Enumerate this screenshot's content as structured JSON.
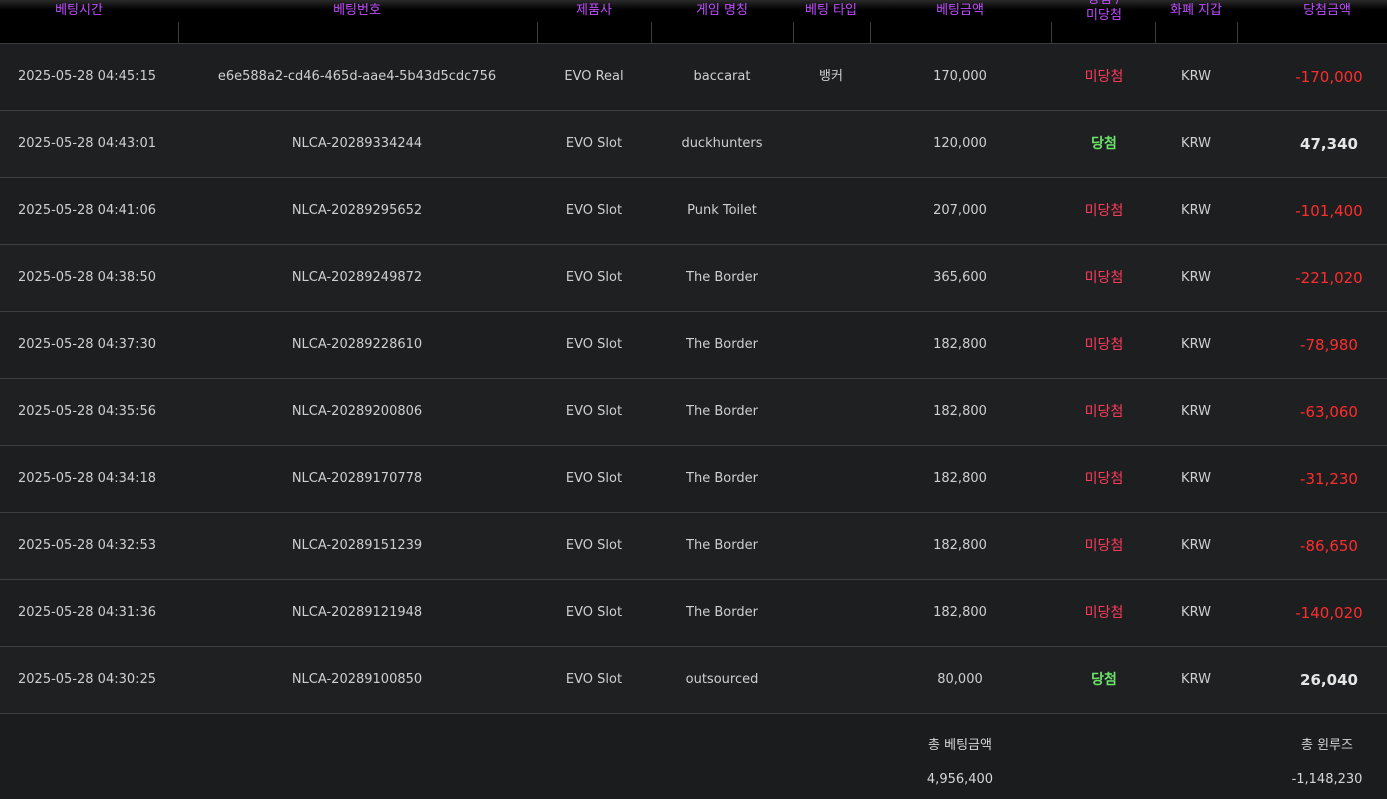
{
  "headers": {
    "time": "베팅시간",
    "bet_no": "베팅번호",
    "provider": "제품사",
    "game": "게임 명칭",
    "bet_type": "베팅 타입",
    "bet_amount": "베팅금액",
    "result_top": "당첨 /",
    "result_bottom": "미당첨",
    "wallet": "화폐 지갑",
    "win_amount": "당첨금액"
  },
  "rows": [
    {
      "time": "2025-05-28 04:45:15",
      "bet_no": "e6e588a2-cd46-465d-aae4-5b43d5cdc756",
      "provider": "EVO Real",
      "game": "baccarat",
      "bet_type": "뱅커",
      "bet_amount": "170,000",
      "result": "미당첨",
      "won": false,
      "wallet": "KRW",
      "win_amount": "-170,000"
    },
    {
      "time": "2025-05-28 04:43:01",
      "bet_no": "NLCA-20289334244",
      "provider": "EVO Slot",
      "game": "duckhunters",
      "bet_type": "",
      "bet_amount": "120,000",
      "result": "당첨",
      "won": true,
      "wallet": "KRW",
      "win_amount": "47,340"
    },
    {
      "time": "2025-05-28 04:41:06",
      "bet_no": "NLCA-20289295652",
      "provider": "EVO Slot",
      "game": "Punk Toilet",
      "bet_type": "",
      "bet_amount": "207,000",
      "result": "미당첨",
      "won": false,
      "wallet": "KRW",
      "win_amount": "-101,400"
    },
    {
      "time": "2025-05-28 04:38:50",
      "bet_no": "NLCA-20289249872",
      "provider": "EVO Slot",
      "game": "The Border",
      "bet_type": "",
      "bet_amount": "365,600",
      "result": "미당첨",
      "won": false,
      "wallet": "KRW",
      "win_amount": "-221,020"
    },
    {
      "time": "2025-05-28 04:37:30",
      "bet_no": "NLCA-20289228610",
      "provider": "EVO Slot",
      "game": "The Border",
      "bet_type": "",
      "bet_amount": "182,800",
      "result": "미당첨",
      "won": false,
      "wallet": "KRW",
      "win_amount": "-78,980"
    },
    {
      "time": "2025-05-28 04:35:56",
      "bet_no": "NLCA-20289200806",
      "provider": "EVO Slot",
      "game": "The Border",
      "bet_type": "",
      "bet_amount": "182,800",
      "result": "미당첨",
      "won": false,
      "wallet": "KRW",
      "win_amount": "-63,060"
    },
    {
      "time": "2025-05-28 04:34:18",
      "bet_no": "NLCA-20289170778",
      "provider": "EVO Slot",
      "game": "The Border",
      "bet_type": "",
      "bet_amount": "182,800",
      "result": "미당첨",
      "won": false,
      "wallet": "KRW",
      "win_amount": "-31,230"
    },
    {
      "time": "2025-05-28 04:32:53",
      "bet_no": "NLCA-20289151239",
      "provider": "EVO Slot",
      "game": "The Border",
      "bet_type": "",
      "bet_amount": "182,800",
      "result": "미당첨",
      "won": false,
      "wallet": "KRW",
      "win_amount": "-86,650"
    },
    {
      "time": "2025-05-28 04:31:36",
      "bet_no": "NLCA-20289121948",
      "provider": "EVO Slot",
      "game": "The Border",
      "bet_type": "",
      "bet_amount": "182,800",
      "result": "미당첨",
      "won": false,
      "wallet": "KRW",
      "win_amount": "-140,020"
    },
    {
      "time": "2025-05-28 04:30:25",
      "bet_no": "NLCA-20289100850",
      "provider": "EVO Slot",
      "game": "outsourced",
      "bet_type": "",
      "bet_amount": "80,000",
      "result": "당첨",
      "won": true,
      "wallet": "KRW",
      "win_amount": "26,040"
    }
  ],
  "footer": {
    "total_bet_label": "총 베팅금액",
    "total_bet_value": "4,956,400",
    "total_winloss_label": "총 윈루즈",
    "total_winloss_value": "-1,148,230"
  },
  "colors": {
    "header_text": "#c04bff",
    "win": "#6be36b",
    "lose": "#ff3b5c",
    "negative_amount": "#ff2d2d"
  }
}
